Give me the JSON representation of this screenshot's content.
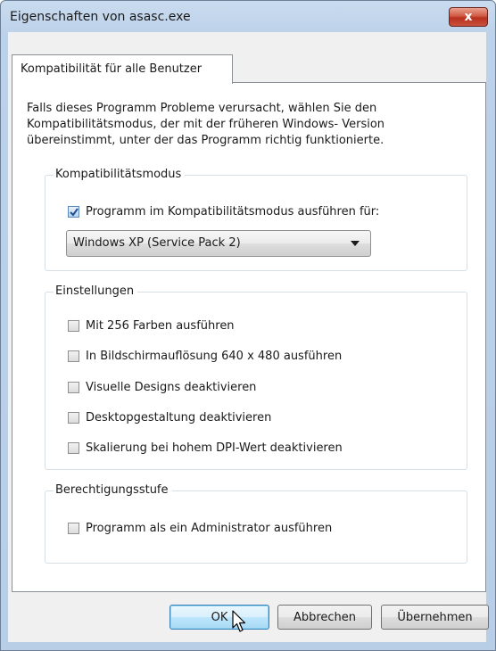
{
  "window": {
    "title": "Eigenschaften von asasc.exe",
    "close_label": "x"
  },
  "tab": {
    "label": "Kompatibilität für alle Benutzer"
  },
  "description": {
    "line1": "Falls dieses Programm Probleme verursacht, wählen Sie den",
    "line2": "Kompatibilitätsmodus, der mit der früheren Windows- Version",
    "line3": "übereinstimmt, unter der das Programm richtig funktionierte."
  },
  "compat_group": {
    "title": "Kompatibilitätsmodus",
    "checkbox_label": "Programm im Kompatibilitätsmodus ausführen für:",
    "checked": true,
    "selected_os": "Windows XP (Service Pack 2)"
  },
  "settings_group": {
    "title": "Einstellungen",
    "items": [
      {
        "label": "Mit 256 Farben ausführen",
        "checked": false
      },
      {
        "label": "In Bildschirmauflösung 640 x 480 ausführen",
        "checked": false
      },
      {
        "label": "Visuelle Designs deaktivieren",
        "checked": false
      },
      {
        "label": "Desktopgestaltung deaktivieren",
        "checked": false
      },
      {
        "label": "Skalierung bei hohem DPI-Wert deaktivieren",
        "checked": false
      }
    ]
  },
  "privilege_group": {
    "title": "Berechtigungsstufe",
    "checkbox_label": "Programm als ein Administrator ausführen",
    "checked": false
  },
  "buttons": {
    "ok": "OK",
    "cancel": "Abbrechen",
    "apply": "Übernehmen"
  },
  "colors": {
    "title_bar": "#bcd1ea",
    "close_button": "#c9513c",
    "checkbox_checked": "#5c89b8",
    "default_button": "#bee6fd"
  }
}
